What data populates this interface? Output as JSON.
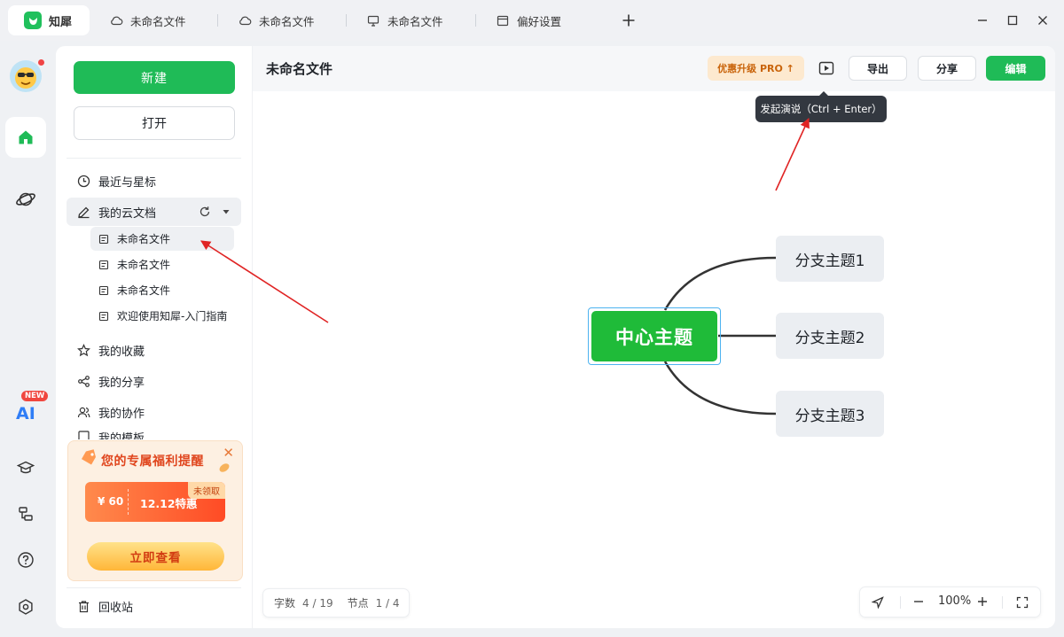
{
  "tabs": [
    {
      "label": "知犀",
      "icon": "app-logo-icon",
      "active": true
    },
    {
      "label": "未命名文件",
      "icon": "cloud-icon"
    },
    {
      "label": "未命名文件",
      "icon": "cloud-icon"
    },
    {
      "label": "未命名文件",
      "icon": "monitor-icon"
    },
    {
      "label": "偏好设置",
      "icon": "window-icon"
    }
  ],
  "rail": {
    "ai_badge": "NEW",
    "ai_label": "AI"
  },
  "sidebar": {
    "new_label": "新建",
    "open_label": "打开",
    "recent_label": "最近与星标",
    "cloud_docs_label": "我的云文档",
    "files": [
      "未命名文件",
      "未命名文件",
      "未命名文件",
      "欢迎使用知犀-入门指南"
    ],
    "favorites_label": "我的收藏",
    "shared_label": "我的分享",
    "collab_label": "我的协作",
    "templates_label": "我的模板",
    "trash_label": "回收站"
  },
  "promo": {
    "title": "您的专属福利提醒",
    "coupon_amount": "¥ 60",
    "coupon_text": "12.12特惠",
    "badge": "未领取",
    "cta": "立即查看"
  },
  "header": {
    "title": "未命名文件",
    "pro_label": "优惠升级 PRO ↑",
    "export_label": "导出",
    "share_label": "分享",
    "edit_label": "编辑",
    "tooltip": "发起演说（Ctrl + Enter）"
  },
  "mindmap": {
    "center": "中心主题",
    "branches": [
      "分支主题1",
      "分支主题2",
      "分支主题3"
    ],
    "accent": "#1fbb39"
  },
  "status": {
    "words_label": "字数",
    "words_value": "4 / 19",
    "nodes_label": "节点",
    "nodes_value": "1 / 4"
  },
  "zoom": {
    "level": "100%"
  },
  "colors": {
    "brand": "#1fbb57",
    "annotation_arrow": "#e02424"
  }
}
